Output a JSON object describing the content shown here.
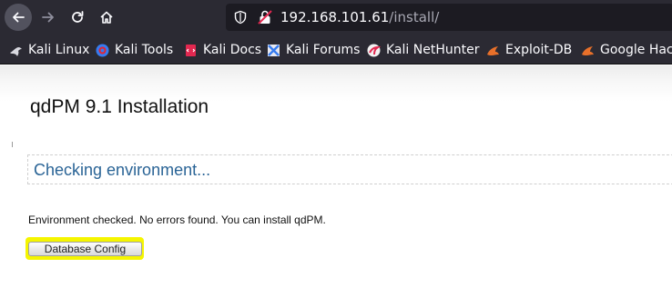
{
  "browser": {
    "url_host": "192.168.101.61",
    "url_path": "/install/",
    "bookmarks": [
      {
        "label": "Kali Linux",
        "icon": "kali-dragon-icon"
      },
      {
        "label": "Kali Tools",
        "icon": "kali-tools-icon"
      },
      {
        "label": "Kali Docs",
        "icon": "kali-docs-icon"
      },
      {
        "label": "Kali Forums",
        "icon": "kali-forums-icon"
      },
      {
        "label": "Kali NetHunter",
        "icon": "kali-nethunter-icon"
      },
      {
        "label": "Exploit-DB",
        "icon": "exploit-db-icon"
      },
      {
        "label": "Google Hacking DB",
        "icon": "google-hacking-icon"
      }
    ]
  },
  "page": {
    "title": "qdPM 9.1 Installation",
    "section_heading": "Checking environment...",
    "status_message": "Environment checked. No errors found. You can install qdPM.",
    "button_label": "Database Config"
  },
  "colors": {
    "toolbar_bg": "#2b2a33",
    "heading_blue": "#2a6496",
    "highlight_yellow": "#f5f500"
  }
}
